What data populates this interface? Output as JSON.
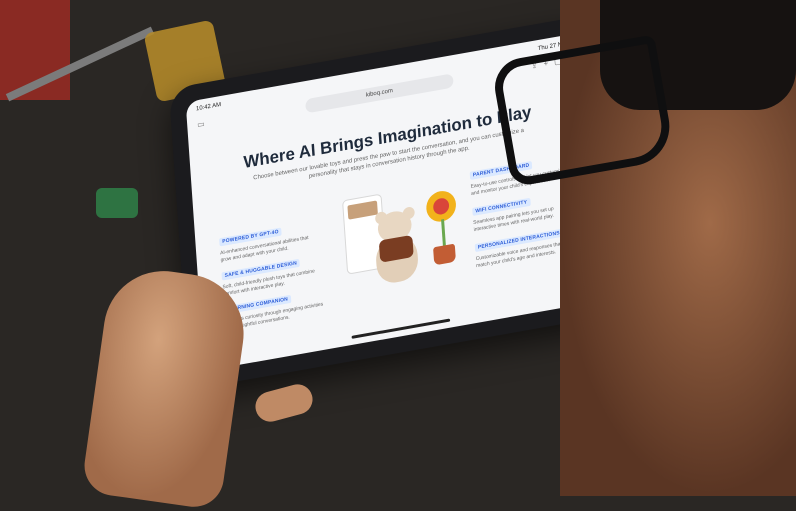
{
  "browser": {
    "url": "kiboq.com",
    "status_time": "10:42 AM",
    "status_date": "Thu 27 Nov"
  },
  "hero": {
    "title": "Where AI Brings Imagination to Play",
    "subtitle": "Choose between our lovable toys and press the paw to start the conversation, and you can customize a personality that stays in conversation history through the app."
  },
  "features_left": [
    {
      "badge": "POWERED BY GPT-4O",
      "desc": "AI-enhanced conversational abilities that grow and adapt with your child."
    },
    {
      "badge": "SAFE & HUGGABLE DESIGN",
      "desc": "Soft, child-friendly plush toys that combine comfort with interactive play."
    },
    {
      "badge": "LEARNING COMPANION",
      "desc": "Nurtures curiosity through engaging activities and thoughtful conversations."
    }
  ],
  "features_right": [
    {
      "badge": "PARENT DASHBOARD",
      "desc": "Easy-to-use controls that let you customize and monitor your child's experience."
    },
    {
      "badge": "WIFI CONNECTIVITY",
      "desc": "Seamless app pairing lets you set up interactive times with real-world play."
    },
    {
      "badge": "PERSONALIZED INTERACTIONS",
      "desc": "Customizable voice and responses that match your child's age and interests."
    }
  ]
}
